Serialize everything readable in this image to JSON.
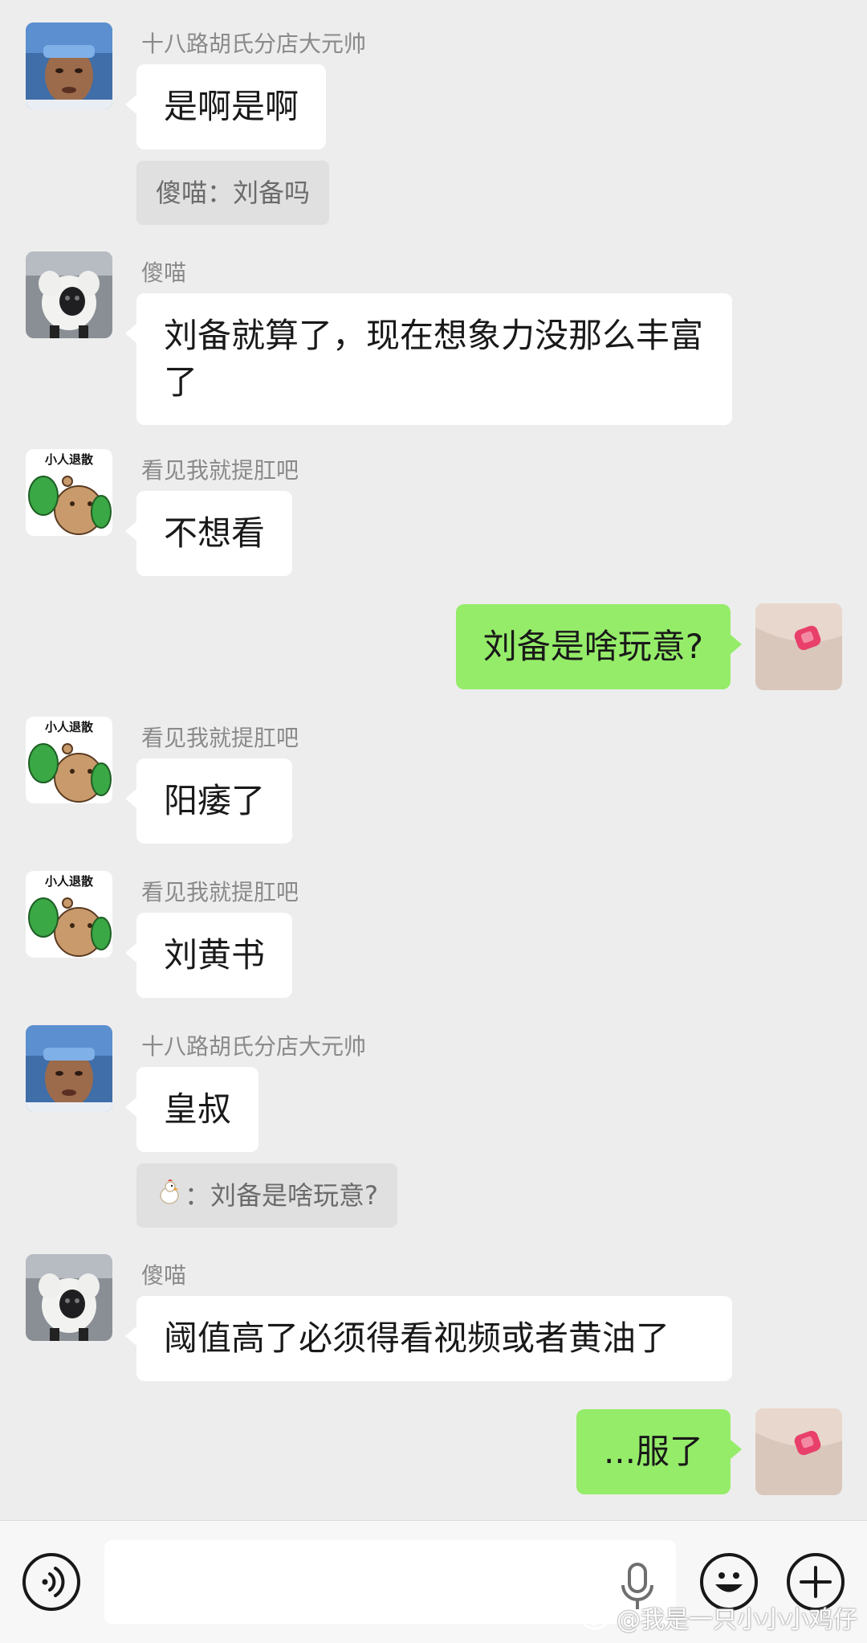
{
  "messages": [
    {
      "sender": "十八路胡氏分店大元帅",
      "text": "是啊是啊",
      "quote": "傻喵：刘备吗"
    },
    {
      "sender": "傻喵",
      "text": "刘备就算了，现在想象力没那么丰富了"
    },
    {
      "sender": "看见我就提肛吧",
      "text": "不想看",
      "avatar_caption": "小人退散"
    },
    {
      "text": "刘备是啥玩意?"
    },
    {
      "sender": "看见我就提肛吧",
      "text": "阳痿了",
      "avatar_caption": "小人退散"
    },
    {
      "sender": "看见我就提肛吧",
      "text": "刘黄书",
      "avatar_caption": "小人退散"
    },
    {
      "sender": "十八路胡氏分店大元帅",
      "text": "皇叔",
      "quote": "：刘备是啥玩意?"
    },
    {
      "sender": "傻喵",
      "text": "阈值高了必须得看视频或者黄油了"
    },
    {
      "text": "...服了"
    }
  ],
  "input": {
    "placeholder": ""
  },
  "watermark": "@我是一只小小小鸡仔",
  "colors": {
    "background": "#ededed",
    "incoming_bubble": "#ffffff",
    "outgoing_bubble": "#95ec69",
    "sender_name": "#8a8a8a"
  },
  "icons": [
    "voice-toggle-icon",
    "microphone-icon",
    "emoji-icon",
    "plus-icon",
    "chick-emoji-icon",
    "weibo-icon"
  ]
}
